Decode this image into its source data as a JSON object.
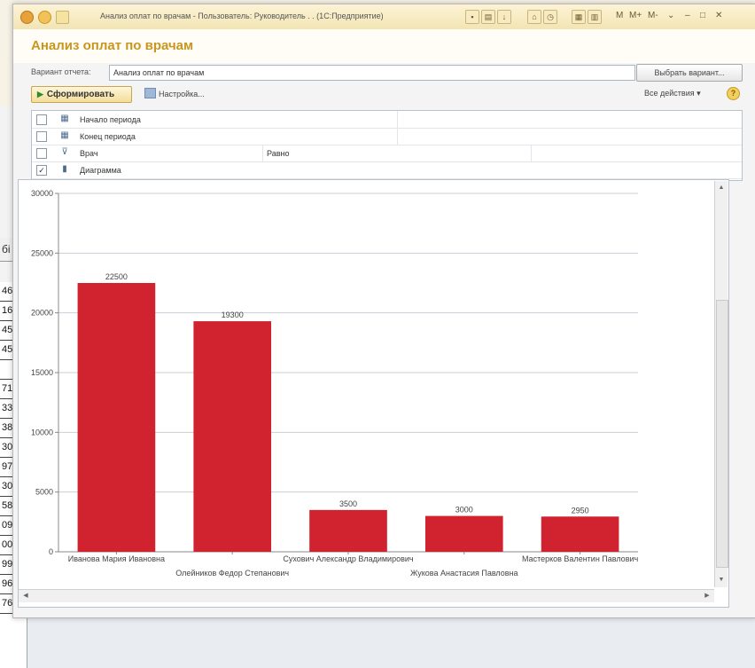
{
  "window": {
    "title": "Анализ оплат по врачам - Пользователь: Руководитель . . (1С:Предприятие)",
    "mm_labels": [
      "M",
      "M+",
      "M-"
    ]
  },
  "header": {
    "title": "Анализ оплат по врачам"
  },
  "variant": {
    "label": "Вариант отчета:",
    "value": "Анализ оплат по врачам",
    "select_button": "Выбрать вариант..."
  },
  "toolbar": {
    "generate_label": "Сформировать",
    "settings_label": "Настройка...",
    "all_actions_label": "Все действия ▾",
    "help_label": "?"
  },
  "settings_rows": [
    {
      "label": "Начало периода",
      "checked": false,
      "icon": "calendar-icon",
      "comparison": "",
      "value": ""
    },
    {
      "label": "Конец периода",
      "checked": false,
      "icon": "calendar-icon",
      "comparison": "",
      "value": ""
    },
    {
      "label": "Врач",
      "checked": false,
      "icon": "filter-icon",
      "comparison": "Равно",
      "value": ""
    },
    {
      "label": "Диаграмма",
      "checked": true,
      "icon": "chart-icon",
      "comparison": "",
      "value": ""
    }
  ],
  "background_panel": {
    "header_fragment": "бі",
    "cells": [
      "46",
      "16",
      "45",
      "45",
      "",
      "71",
      "33",
      "38",
      "30",
      "97",
      "30",
      "58",
      "09",
      "00",
      "99",
      "96",
      "76"
    ]
  },
  "colors": {
    "bar": "#d0232f",
    "accent": "#c8961e"
  },
  "chart_data": {
    "type": "bar",
    "categories": [
      "Иванова Мария Ивановна",
      "Олейников Федор Степанович",
      "Сухович Александр Владимирович",
      "Жукова Анастасия Павловна",
      "Мастерков Валентин Павлович"
    ],
    "values": [
      22500,
      19300,
      3500,
      3000,
      2950
    ],
    "data_labels": [
      "22500",
      "19300",
      "3500",
      "3000",
      "2950"
    ],
    "yticks": [
      "0",
      "5000",
      "10000",
      "15000",
      "20000",
      "25000",
      "30000"
    ],
    "ylim": [
      0,
      30000
    ],
    "grid": true,
    "title": "",
    "xlabel": "",
    "ylabel": ""
  }
}
